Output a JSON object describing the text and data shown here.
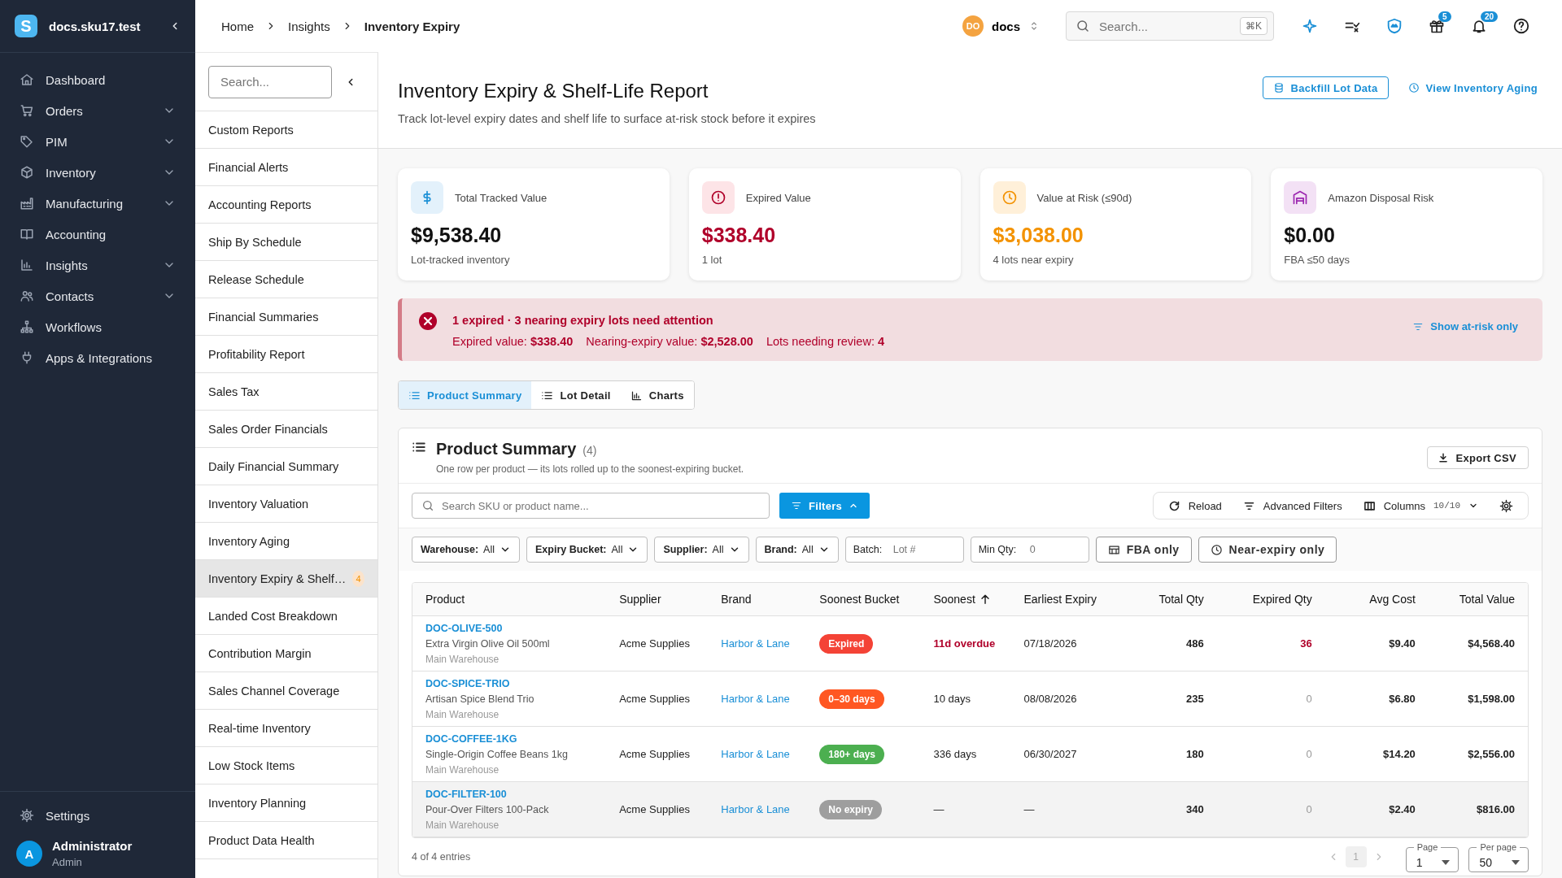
{
  "brand": {
    "logo_letter": "S",
    "name": "docs.sku17.test"
  },
  "nav": [
    {
      "label": "Dashboard",
      "expandable": false
    },
    {
      "label": "Orders",
      "expandable": true
    },
    {
      "label": "PIM",
      "expandable": true
    },
    {
      "label": "Inventory",
      "expandable": true
    },
    {
      "label": "Manufacturing",
      "expandable": true
    },
    {
      "label": "Accounting",
      "expandable": false
    },
    {
      "label": "Insights",
      "expandable": true
    },
    {
      "label": "Contacts",
      "expandable": true
    },
    {
      "label": "Workflows",
      "expandable": false
    },
    {
      "label": "Apps & Integrations",
      "expandable": false
    }
  ],
  "settings": "Settings",
  "user": {
    "initial": "A",
    "name": "Administrator",
    "role": "Admin"
  },
  "report_menu": {
    "search_placeholder": "Search...",
    "items": [
      {
        "label": "Custom Reports",
        "selected": false
      },
      {
        "label": "Financial Alerts",
        "selected": false
      },
      {
        "label": "Accounting Reports",
        "selected": false
      },
      {
        "label": "Ship By Schedule",
        "selected": false
      },
      {
        "label": "Release Schedule",
        "selected": false
      },
      {
        "label": "Financial Summaries",
        "selected": false
      },
      {
        "label": "Profitability Report",
        "selected": false
      },
      {
        "label": "Sales Tax",
        "selected": false
      },
      {
        "label": "Sales Order Financials",
        "selected": false
      },
      {
        "label": "Daily Financial Summary",
        "selected": false
      },
      {
        "label": "Inventory Valuation",
        "selected": false
      },
      {
        "label": "Inventory Aging",
        "selected": false
      },
      {
        "label": "Inventory Expiry & Shelf…",
        "selected": true,
        "badge": "4"
      },
      {
        "label": "Landed Cost Breakdown",
        "selected": false
      },
      {
        "label": "Contribution Margin",
        "selected": false
      },
      {
        "label": "Sales Channel Coverage",
        "selected": false
      },
      {
        "label": "Real-time Inventory",
        "selected": false
      },
      {
        "label": "Low Stock Items",
        "selected": false
      },
      {
        "label": "Inventory Planning",
        "selected": false
      },
      {
        "label": "Product Data Health",
        "selected": false
      }
    ]
  },
  "breadcrumb": [
    "Home",
    "Insights",
    "Inventory Expiry"
  ],
  "topbar": {
    "workspace": {
      "initials": "DO",
      "name": "docs"
    },
    "search": {
      "placeholder": "Search...",
      "shortcut": "⌘K"
    },
    "gift_badge": "5",
    "notifications_badge": "20"
  },
  "page": {
    "title": "Inventory Expiry & Shelf-Life Report",
    "subtitle": "Track lot-level expiry dates and shelf life to surface at-risk stock before it expires",
    "actions": [
      "Backfill Lot Data",
      "View Inventory Aging"
    ]
  },
  "kpis": [
    {
      "kind": "money",
      "label": "Total Tracked Value",
      "value": "$9,538.40",
      "caption": "Lot-tracked inventory",
      "color": "#111111"
    },
    {
      "kind": "expired",
      "label": "Expired Value",
      "value": "$338.40",
      "caption": "1 lot",
      "color": "#b0002a"
    },
    {
      "kind": "risk",
      "label": "Value at Risk (≤90d)",
      "value": "$3,038.00",
      "caption": "4 lots near expiry",
      "color": "#f39200"
    },
    {
      "kind": "disposal",
      "label": "Amazon Disposal Risk",
      "value": "$0.00",
      "caption": "FBA ≤50 days",
      "color": "#111111"
    }
  ],
  "alert": {
    "title": "1 expired · 3 nearing expiry lots need attention",
    "details": [
      "Expired value: **$338.40**",
      "Nearing-expiry value: **$2,528.00**",
      "Lots needing review: **4**"
    ],
    "action": "Show at-risk only"
  },
  "view_tabs": [
    {
      "kind": "summary",
      "label": "Product Summary",
      "selected": true
    },
    {
      "kind": "lots",
      "label": "Lot Detail",
      "selected": false
    },
    {
      "kind": "charts",
      "label": "Charts",
      "selected": false
    }
  ],
  "panel": {
    "title": "Product Summary",
    "count": "(4)",
    "subtitle": "One row per product — its lots rolled up to the soonest-expiring bucket.",
    "export": "Export CSV",
    "search_placeholder": "Search SKU or product name...",
    "filters_button": "Filters",
    "toolbar": {
      "reload": "Reload",
      "advanced": "Advanced Filters",
      "columns": "Columns",
      "columns_count": "10/10"
    },
    "filters": [
      {
        "kind": "select",
        "label": "Warehouse:",
        "value": "All"
      },
      {
        "kind": "select",
        "label": "Expiry Bucket:",
        "value": "All"
      },
      {
        "kind": "select",
        "label": "Supplier:",
        "value": "All"
      },
      {
        "kind": "select",
        "label": "Brand:",
        "value": "All"
      },
      {
        "kind": "input",
        "label": "Batch:",
        "placeholder": "Lot #"
      },
      {
        "kind": "input",
        "label": "Min Qty:",
        "placeholder": "0"
      },
      {
        "kind": "fba",
        "label": "FBA only"
      },
      {
        "kind": "near",
        "label": "Near-expiry only"
      }
    ]
  },
  "table": {
    "columns": [
      {
        "label": "Product",
        "sorted": false
      },
      {
        "label": "Supplier",
        "sorted": false
      },
      {
        "label": "Brand",
        "sorted": false
      },
      {
        "label": "Soonest Bucket",
        "sorted": false
      },
      {
        "label": "Soonest",
        "sorted": true
      },
      {
        "label": "Earliest Expiry",
        "sorted": false
      },
      {
        "label": "Total Qty",
        "sorted": false
      },
      {
        "label": "Expired Qty",
        "sorted": false
      },
      {
        "label": "Avg Cost",
        "sorted": false
      },
      {
        "label": "Total Value",
        "sorted": false
      }
    ],
    "rows": [
      {
        "sku": "DOC-OLIVE-500",
        "name": "Extra Virgin Olive Oil 500ml",
        "warehouse": "Main Warehouse",
        "supplier": "Acme Supplies",
        "brand": "Harbor & Lane",
        "bucket": {
          "label": "Expired",
          "color": "#f44336"
        },
        "soonest": "11d overdue",
        "soonest_alert": true,
        "earliest_expiry": "07/18/2026",
        "total_qty": "486",
        "expired_qty": "36",
        "expired_alert": true,
        "avg_cost": "$9.40",
        "total_value": "$4,568.40",
        "selected": false
      },
      {
        "sku": "DOC-SPICE-TRIO",
        "name": "Artisan Spice Blend Trio",
        "warehouse": "Main Warehouse",
        "supplier": "Acme Supplies",
        "brand": "Harbor & Lane",
        "bucket": {
          "label": "0–30 days",
          "color": "#ff5722"
        },
        "soonest": "10 days",
        "soonest_alert": false,
        "earliest_expiry": "08/08/2026",
        "total_qty": "235",
        "expired_qty": "0",
        "expired_alert": false,
        "avg_cost": "$6.80",
        "total_value": "$1,598.00",
        "selected": false
      },
      {
        "sku": "DOC-COFFEE-1KG",
        "name": "Single-Origin Coffee Beans 1kg",
        "warehouse": "Main Warehouse",
        "supplier": "Acme Supplies",
        "brand": "Harbor & Lane",
        "bucket": {
          "label": "180+ days",
          "color": "#4caf50"
        },
        "soonest": "336 days",
        "soonest_alert": false,
        "earliest_expiry": "06/30/2027",
        "total_qty": "180",
        "expired_qty": "0",
        "expired_alert": false,
        "avg_cost": "$14.20",
        "total_value": "$2,556.00",
        "selected": false
      },
      {
        "sku": "DOC-FILTER-100",
        "name": "Pour-Over Filters 100-Pack",
        "warehouse": "Main Warehouse",
        "supplier": "Acme Supplies",
        "brand": "Harbor & Lane",
        "bucket": {
          "label": "No expiry",
          "color": "#9e9e9e"
        },
        "soonest": "—",
        "soonest_alert": false,
        "earliest_expiry": "—",
        "total_qty": "340",
        "expired_qty": "0",
        "expired_alert": false,
        "avg_cost": "$2.40",
        "total_value": "$816.00",
        "selected": true
      }
    ]
  },
  "footer": {
    "entries": "4 of 4 entries",
    "current_page": "1",
    "page_label": "Page",
    "page": "1",
    "per_page_label": "Per page",
    "per_page": "50"
  }
}
